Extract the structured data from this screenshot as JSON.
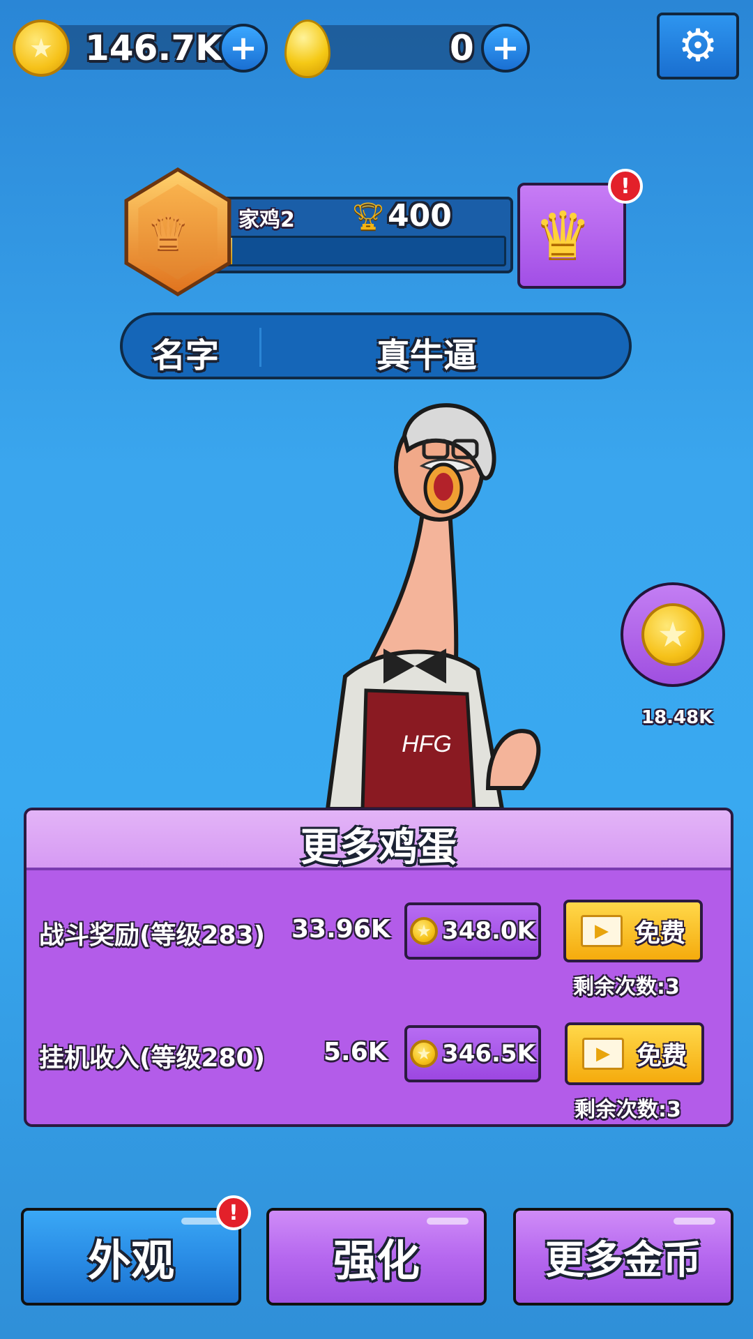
{
  "top_bar": {
    "coins_value": "146.7K",
    "eggs_value": "0",
    "plus_symbol": "+",
    "alert_symbol": "!"
  },
  "player": {
    "rank_name": "家鸡2",
    "trophies": "400",
    "rank_progress": 0.03,
    "name_label": "名字",
    "name_value": "真牛逼"
  },
  "character": {
    "apron_text": "HFG"
  },
  "side_reward": {
    "value": "18.48K"
  },
  "more_eggs_panel": {
    "title": "更多鸡蛋",
    "rows": [
      {
        "label": "战斗奖励(等级283)",
        "value": "33.96K",
        "cost": "348.0K",
        "free_label": "免费",
        "remaining": "剩余次数:3"
      },
      {
        "label": "挂机收入(等级280)",
        "value": "5.6K",
        "cost": "346.5K",
        "free_label": "免费",
        "remaining": "剩余次数:3"
      }
    ]
  },
  "bottom_nav": {
    "appearance": "外观",
    "upgrade": "强化",
    "more_coins": "更多金币"
  },
  "colors": {
    "background": "#39a9f0",
    "panel_purple": "#b35ce9",
    "button_blue": "#2a8de6",
    "button_yellow": "#f5ab0d",
    "alert_red": "#e3202a"
  },
  "icons": [
    "coin-icon",
    "egg-icon",
    "plus-icon",
    "gear-icon",
    "crown-icon",
    "trophy-icon",
    "alert-icon",
    "play-video-icon"
  ]
}
